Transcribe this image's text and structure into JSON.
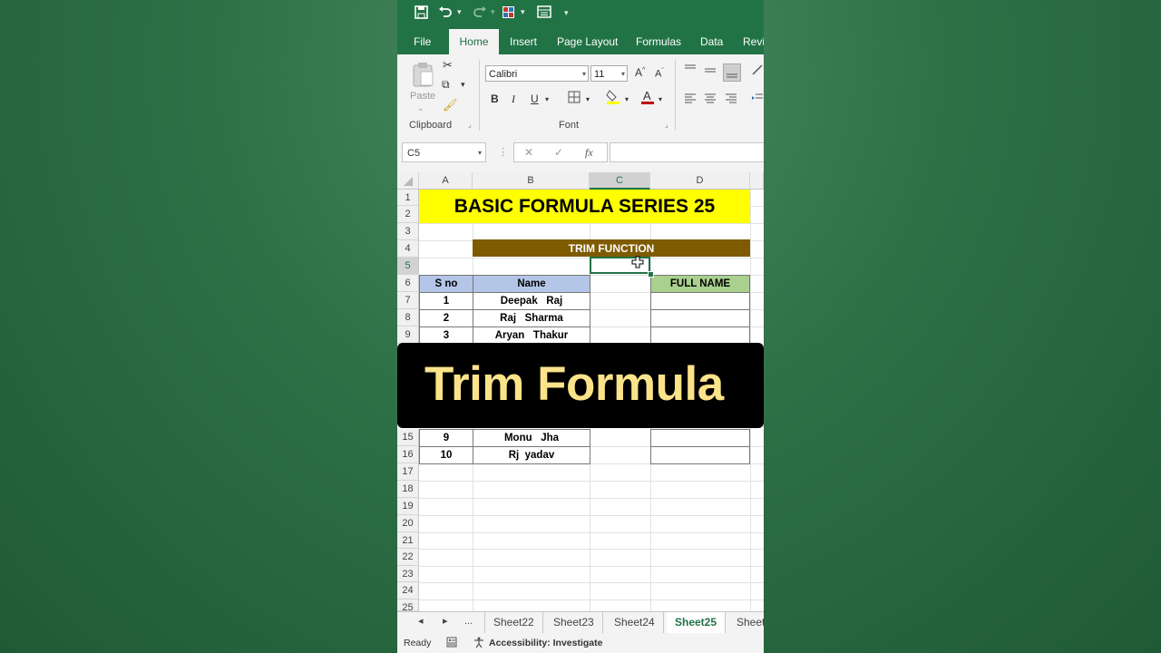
{
  "qat": {
    "save_icon": "save-icon",
    "undo_icon": "undo-icon",
    "redo_icon": "redo-icon"
  },
  "tabs": [
    "File",
    "Home",
    "Insert",
    "Page Layout",
    "Formulas",
    "Data",
    "Revi"
  ],
  "active_tab": "Home",
  "ribbon": {
    "paste_label": "Paste",
    "clipboard_label": "Clipboard",
    "font_label": "Font",
    "font_name": "Calibri",
    "font_size": "11",
    "bold": "B",
    "italic": "I",
    "underline": "U",
    "grow_font": "A",
    "shrink_font": "A"
  },
  "formula_bar": {
    "name_box": "C5",
    "cancel": "✕",
    "enter": "✓",
    "fx": "fx",
    "value": ""
  },
  "columns": [
    "A",
    "B",
    "C",
    "D"
  ],
  "selected_column": "C",
  "rows": [
    "1",
    "2",
    "3",
    "4",
    "5",
    "6",
    "7",
    "8",
    "9",
    "15",
    "16",
    "17",
    "18",
    "19",
    "20",
    "21",
    "22",
    "23",
    "24",
    "25"
  ],
  "sheet": {
    "title": "BASIC FORMULA SERIES 25",
    "section_header": "TRIM FUNCTION",
    "headers": {
      "sno": "S no",
      "name": "Name",
      "full_name": "FULL NAME"
    },
    "records": [
      {
        "sno": "1",
        "name": "Deepak   Raj"
      },
      {
        "sno": "2",
        "name": "Raj   Sharma"
      },
      {
        "sno": "3",
        "name": "Aryan   Thakur"
      },
      {
        "sno": "9",
        "name": "Monu   Jha"
      },
      {
        "sno": "10",
        "name": "Rj  yadav"
      }
    ]
  },
  "banner": {
    "text": "Trim Formula"
  },
  "sheet_tabs": [
    "Sheet22",
    "Sheet23",
    "Sheet24",
    "Sheet25",
    "Sheet"
  ],
  "active_sheet": "Sheet25",
  "sheet_nav": {
    "prev": "◂",
    "next": "▸",
    "more": "..."
  },
  "status": {
    "ready": "Ready",
    "accessibility": "Accessibility: Investigate"
  },
  "colors": {
    "excel_green": "#217346",
    "title_yellow": "#ffff00",
    "header_brown": "#7f5b00",
    "name_header_blue": "#b4c6e7",
    "fullname_header_green": "#a9d08e",
    "banner_text": "#fbe38a"
  }
}
